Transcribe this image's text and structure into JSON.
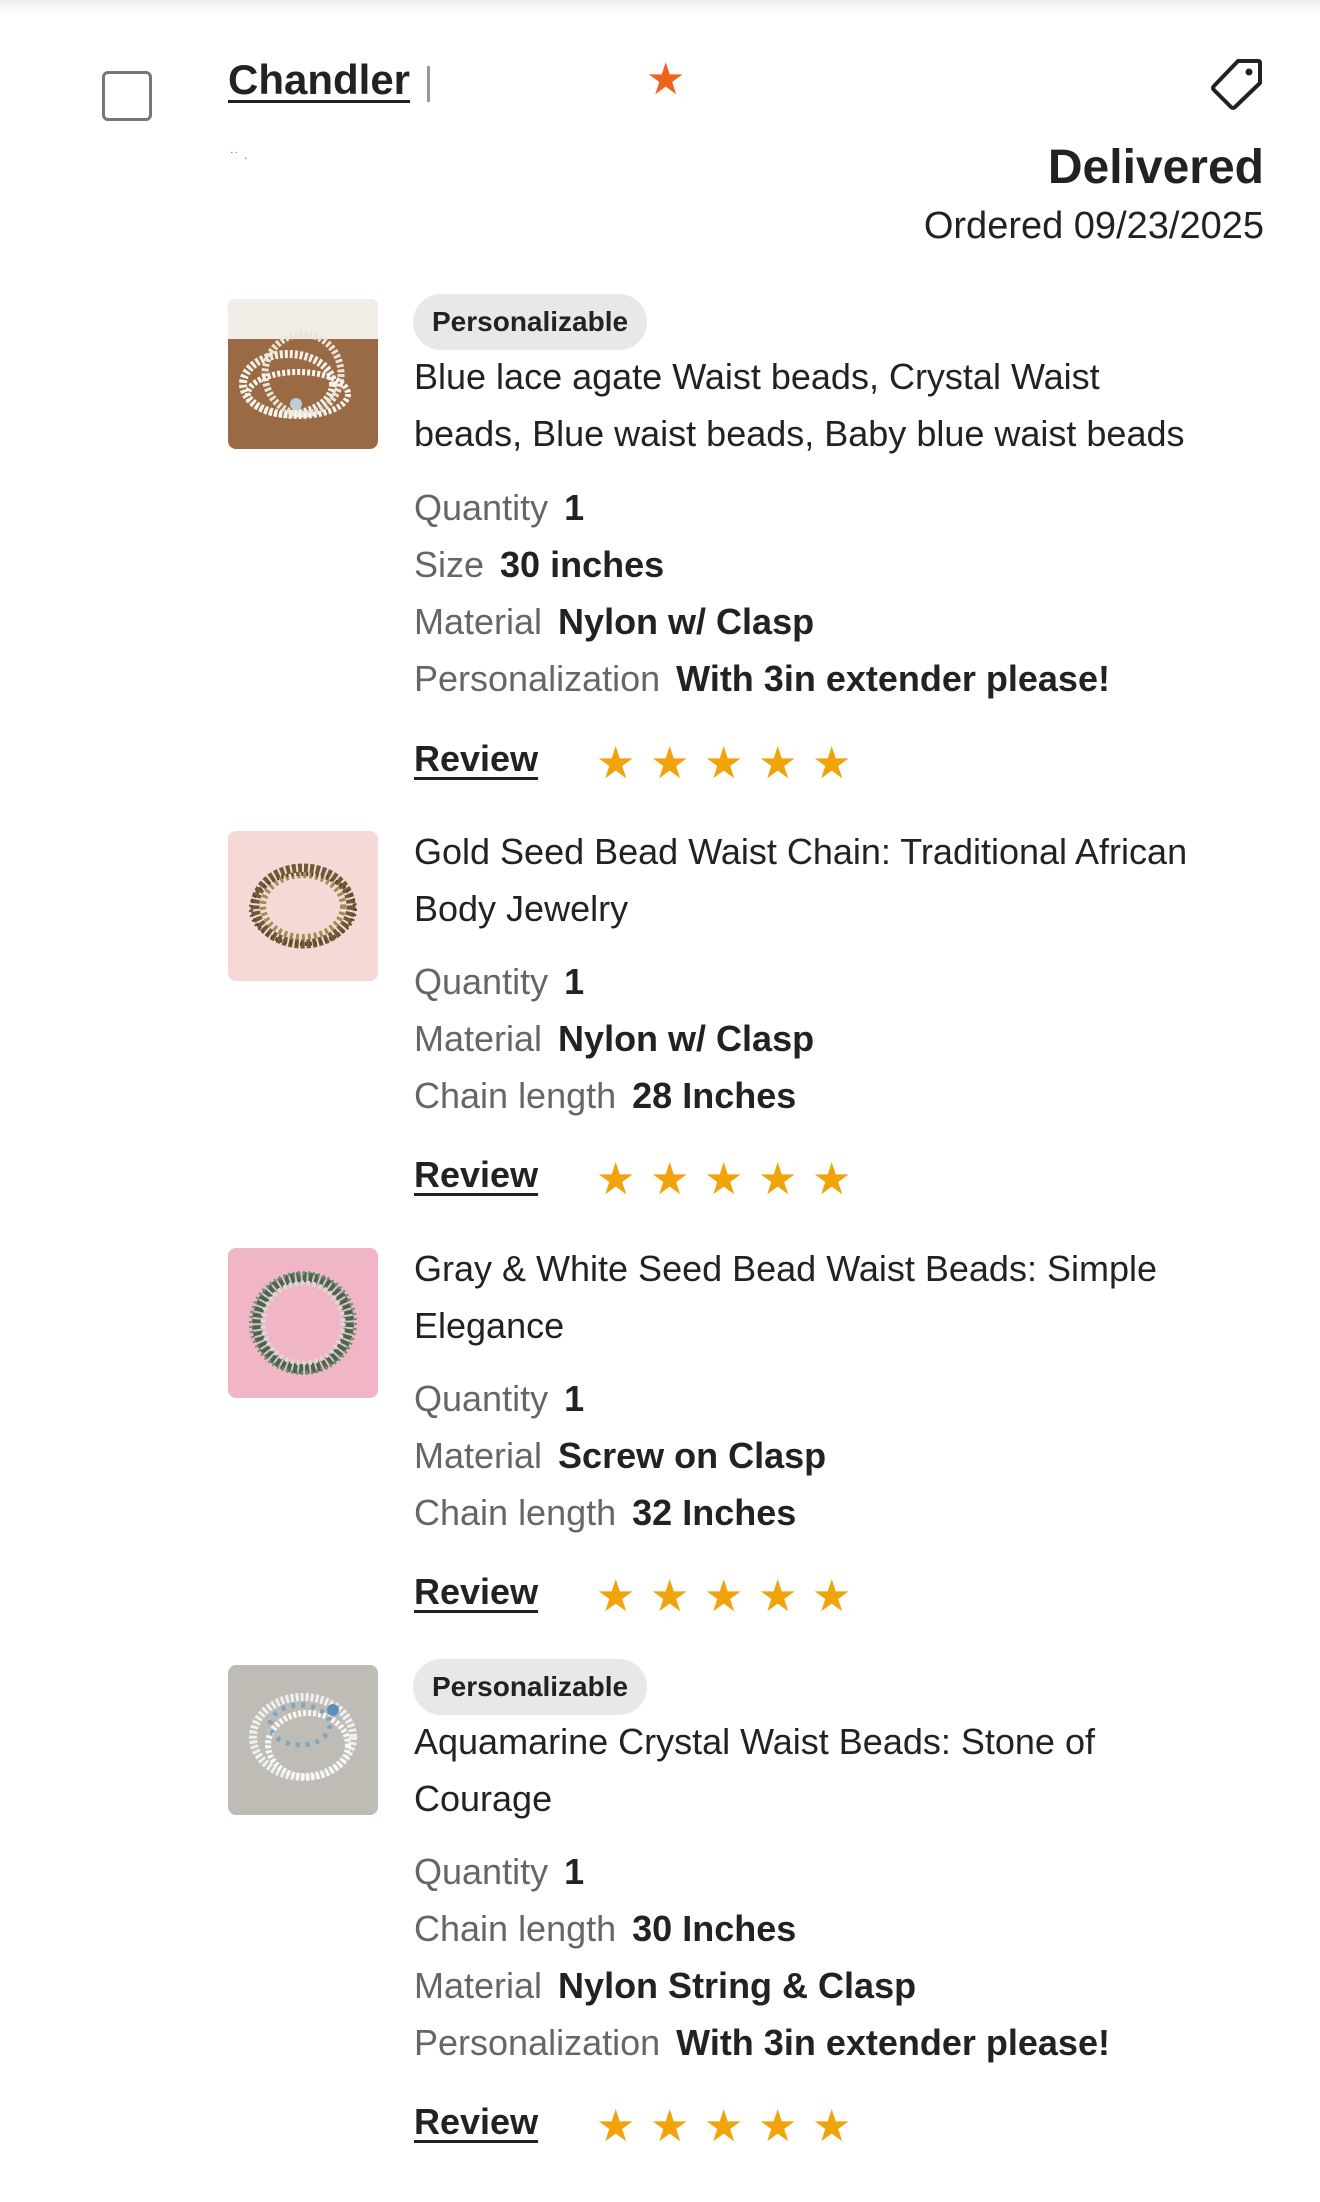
{
  "order": {
    "seller": "Chandler",
    "status": "Delivered",
    "ordered": "Ordered 09/23/2025"
  },
  "icons": {
    "star_badge": "★",
    "tag": "tag-icon",
    "rating_star": "★"
  },
  "colors": {
    "star_badge": "#f1641e",
    "rating_star": "#f0a30a",
    "badge_bg": "#e8e8e8"
  },
  "review_label": "Review",
  "items": [
    {
      "badge": "Personalizable",
      "title_line1": "Blue lace agate Waist beads, Crystal Waist",
      "title_line2": "beads, Blue waist beads, Baby blue waist beads",
      "details": [
        {
          "k": "Quantity",
          "v": "1"
        },
        {
          "k": "Size",
          "v": "30 inches"
        },
        {
          "k": "Material",
          "v": "Nylon w/ Clasp"
        },
        {
          "k": "Personalization",
          "v": "With 3in extender please!"
        }
      ],
      "rating": 5
    },
    {
      "title_line1": "Gold Seed Bead Waist Chain: Traditional African",
      "title_line2": "Body Jewelry",
      "details": [
        {
          "k": "Quantity",
          "v": "1"
        },
        {
          "k": "Material",
          "v": "Nylon w/ Clasp"
        },
        {
          "k": "Chain length",
          "v": "28 Inches"
        }
      ],
      "rating": 5
    },
    {
      "title_line1": "Gray & White Seed Bead Waist Beads: Simple",
      "title_line2": "Elegance",
      "details": [
        {
          "k": "Quantity",
          "v": "1"
        },
        {
          "k": "Material",
          "v": "Screw on Clasp"
        },
        {
          "k": "Chain length",
          "v": "32 Inches"
        }
      ],
      "rating": 5
    },
    {
      "badge": "Personalizable",
      "title_line1": "Aquamarine Crystal Waist Beads: Stone of",
      "title_line2": "Courage",
      "details": [
        {
          "k": "Quantity",
          "v": "1"
        },
        {
          "k": "Chain length",
          "v": "30 Inches"
        },
        {
          "k": "Material",
          "v": "Nylon String & Clasp"
        },
        {
          "k": "Personalization",
          "v": "With 3in extender please!"
        }
      ],
      "rating": 5
    }
  ]
}
